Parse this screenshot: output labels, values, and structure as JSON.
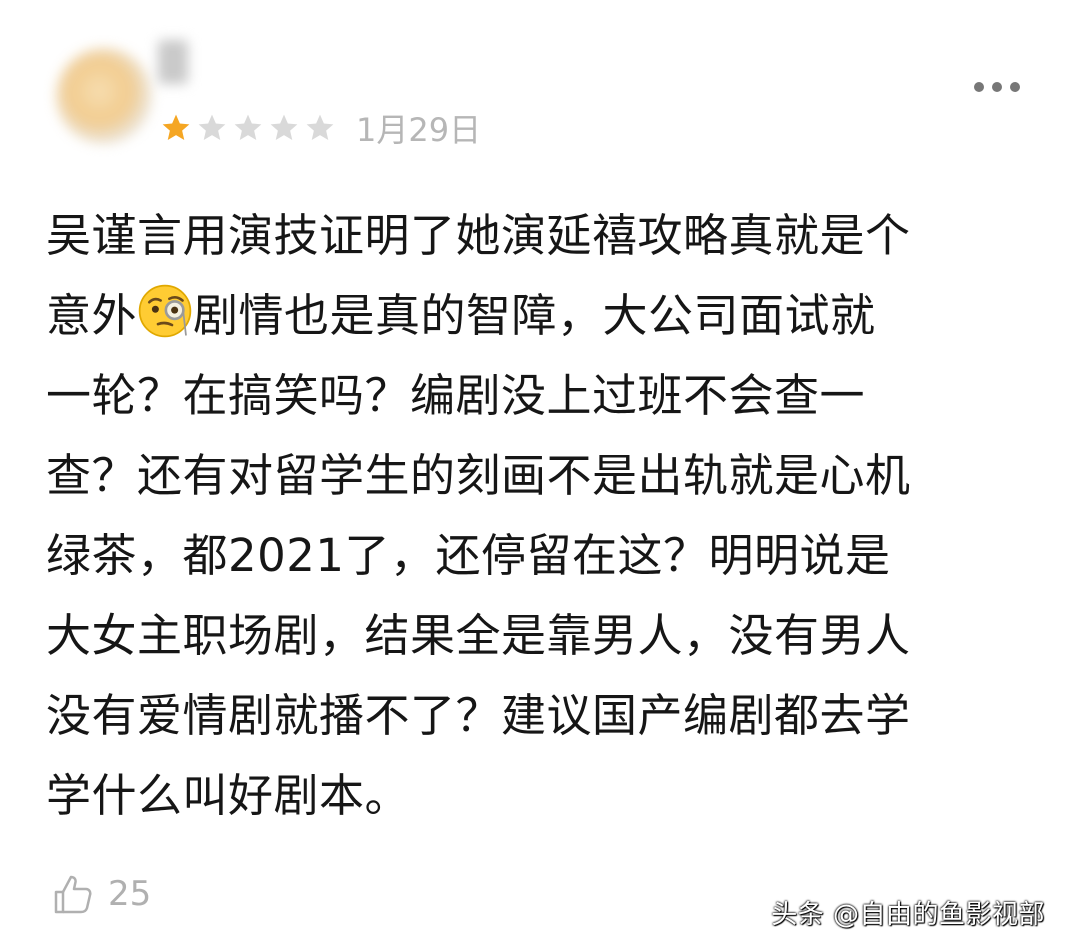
{
  "review": {
    "rating": 1,
    "max_rating": 5,
    "date": "1月29日",
    "lines": [
      "吴谨言用演技证明了她演延禧攻略真就是个",
      "剧情也是真的智障，大公司面试就",
      "一轮？在搞笑吗？编剧没上过班不会查一",
      "查？还有对留学生的刻画不是出轨就是心机",
      "绿茶，都2021了，还停留在这？明明说是",
      "大女主职场剧，结果全是靠男人，没有男人",
      "没有爱情剧就播不了？建议国产编剧都去学",
      "学什么叫好剧本。"
    ],
    "line2_prefix": "意外",
    "emoji_icon": "monocle-face-icon",
    "likes": "25"
  },
  "watermark": "头条 @自由的鱼影视部",
  "colors": {
    "star_filled": "#f5a623",
    "star_empty": "#d9d9d9",
    "meta_text": "#b6b6b6"
  }
}
